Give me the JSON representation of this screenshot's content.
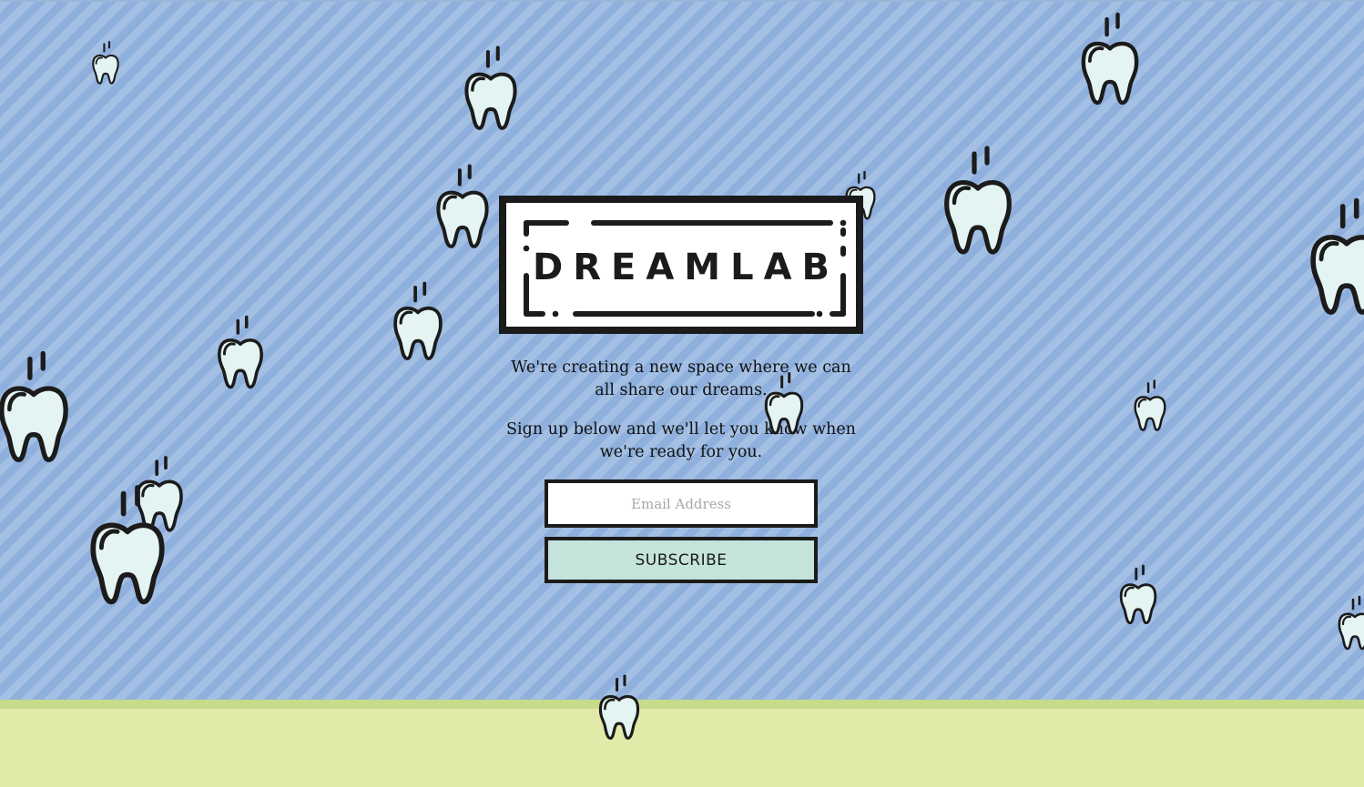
{
  "logo": {
    "text": "DREAMLAB"
  },
  "intro": {
    "line1": "We're creating a new space where we can all share our dreams.",
    "line2": "Sign up below and we'll let you know when we're ready for you."
  },
  "form": {
    "email_placeholder": "Email Address",
    "email_value": "",
    "subscribe_label": "SUBSCRIBE"
  },
  "colors": {
    "sky": "#a3bfe3",
    "ground": "#e2eaa9",
    "tooth_fill": "#e3f4f2",
    "button_fill": "#c4e3db",
    "ink": "#1b1b1b"
  },
  "decor_icons": [
    "falling-tooth-icon"
  ]
}
